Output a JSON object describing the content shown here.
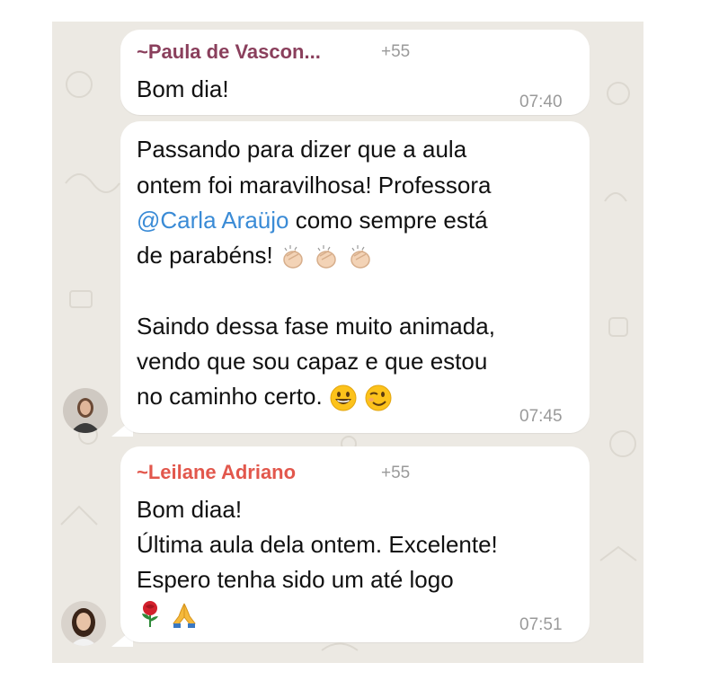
{
  "messages": [
    {
      "sender": "~Paula de Vascon...",
      "phone": "+55",
      "text": "Bom dia!",
      "time": "07:40",
      "sender_color": "#8a3f5c"
    },
    {
      "lines": {
        "l1": "Passando para dizer que a aula",
        "l2": "ontem foi maravilhosa! Professora",
        "l3_mention": "@Carla Araüjo",
        "l3_rest": " como sempre está",
        "l4": "de parabéns!",
        "l5": "Saindo dessa fase muito animada,",
        "l6": "vendo que sou capaz e que estou",
        "l7": "no caminho certo."
      },
      "time": "07:45"
    },
    {
      "sender": "~Leilane Adriano",
      "phone": "+55",
      "lines": {
        "l1": "Bom diaa!",
        "l2": "Última aula dela ontem. Excelente!",
        "l3": "Espero tenha sido um até logo"
      },
      "time": "07:51",
      "sender_color": "#e2574c"
    }
  ],
  "colors": {
    "chat_background": "#ece9e3",
    "bubble": "#ffffff",
    "mention": "#3a8bd6",
    "timestamp": "#9a9a9a"
  },
  "icons": [
    "clapping-hands-icon",
    "grinning-face-icon",
    "winking-face-icon",
    "rose-icon",
    "folded-hands-icon"
  ]
}
